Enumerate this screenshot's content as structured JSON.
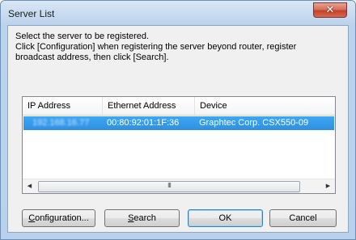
{
  "window": {
    "title": "Server List",
    "close_glyph": "✕"
  },
  "instructions": {
    "line1": "Select the server to be registered.",
    "line2": "Click [Configuration] when registering the server beyond router, register",
    "line3": "broadcast address, then click [Search]."
  },
  "list": {
    "columns": [
      "IP Address",
      "Ethernet Address",
      "Device"
    ],
    "rows": [
      {
        "ip": "192.168.16.77",
        "mac": "00:80:92:01:1F:36",
        "device": "Graphtec Corp. CSX550-09",
        "selected": true
      }
    ],
    "scroll_left_glyph": "◀",
    "scroll_right_glyph": "▶",
    "thumb_grip": "III"
  },
  "buttons": {
    "configuration": "Configuration...",
    "search": "Search",
    "ok": "OK",
    "cancel": "Cancel"
  },
  "colors": {
    "selection": "#3399ff",
    "title_bar": "#bcd2ec",
    "close_button": "#c7493a"
  },
  "icons": [
    "close-icon",
    "scroll-left-icon",
    "scroll-right-icon"
  ]
}
